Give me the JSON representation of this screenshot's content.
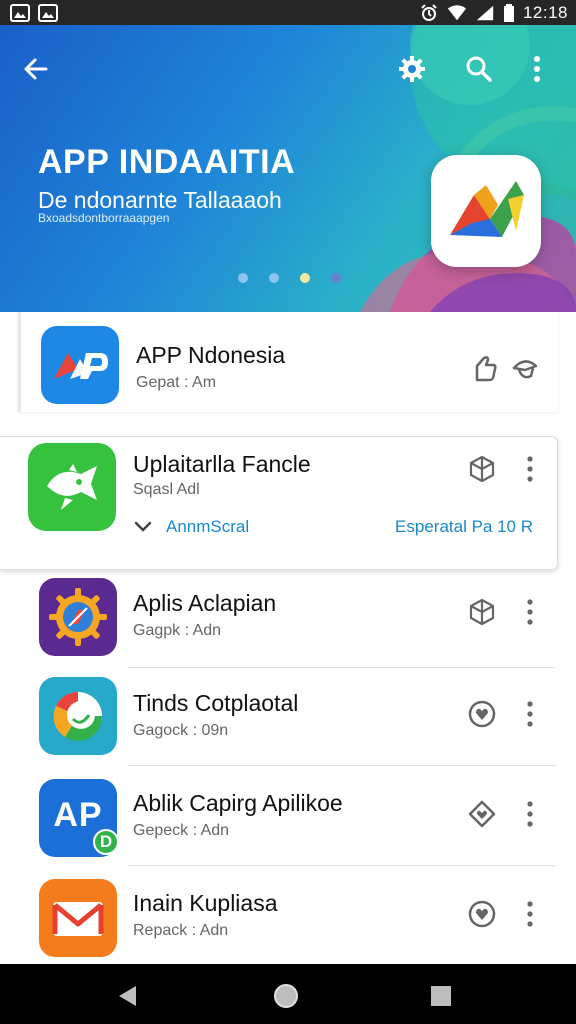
{
  "status_bar": {
    "time": "12:18",
    "left_icons": [
      "image-icon",
      "image-icon"
    ],
    "right_icons": [
      "alarm-icon",
      "wifi-icon",
      "signal-icon",
      "battery-icon"
    ]
  },
  "hero": {
    "title": "APP INDAAITIA",
    "subtitle": "De ndonarnte Tallaaaoh",
    "caption": "Bxoadsdontborraaapgen",
    "toolbar_icons": [
      "back-arrow-icon",
      "gear-icon",
      "search-icon",
      "more-vert-icon"
    ],
    "carousel_pages": 4,
    "carousel_active_index": 2,
    "colors": {
      "gradient_start": "#1a5fc8",
      "gradient_end": "#33b7a9",
      "active_dot": "#f3e8a0"
    }
  },
  "apps": [
    {
      "name": "APP Ndonesia",
      "subtitle": "Gepat : Am",
      "icon": "ap-logo-icon",
      "icon_color": "#1e88e5",
      "action_icon": "hand-icon",
      "second_icon": "hat-icon"
    },
    {
      "name": "Uplaitarlla Fancle",
      "subtitle": "Sqasl Adl",
      "icon": "fish-chat-icon",
      "icon_color": "#36c23f",
      "action_icon": "cube-icon",
      "second_icon": "more-vert-icon",
      "expanded": {
        "left_label": "AnnmScral",
        "right_label": "Esperatal Pa 10 R",
        "chevron": "chevron-down-icon"
      }
    },
    {
      "name": "Aplis Aclapian",
      "subtitle": "Gagpk : Adn",
      "icon": "compass-icon",
      "icon_color": "#5b2a91",
      "action_icon": "cube-icon",
      "second_icon": "more-vert-icon"
    },
    {
      "name": "Tinds Cotplaotal",
      "subtitle": "Gagock : 09n",
      "icon": "circle-logo-icon",
      "icon_color": "#27a9c9",
      "action_icon": "heart-icon",
      "second_icon": "more-vert-icon"
    },
    {
      "name": "Ablik Capirg Apilikoe",
      "subtitle": "Gepeck : Adn",
      "icon": "ap-text-icon",
      "icon_color": "#1c6fd6",
      "icon_text": "AP",
      "badge_text": "D",
      "action_icon": "tag-icon",
      "second_icon": "more-vert-icon"
    },
    {
      "name": "Inain Kupliasa",
      "subtitle": "Repack : Adn",
      "icon": "mail-icon",
      "icon_color": "#f57c1c",
      "action_icon": "heart-icon",
      "second_icon": "more-vert-icon"
    }
  ],
  "nav_bar": {
    "buttons": [
      "back-triangle-icon",
      "home-circle-icon",
      "recents-square-icon"
    ]
  }
}
